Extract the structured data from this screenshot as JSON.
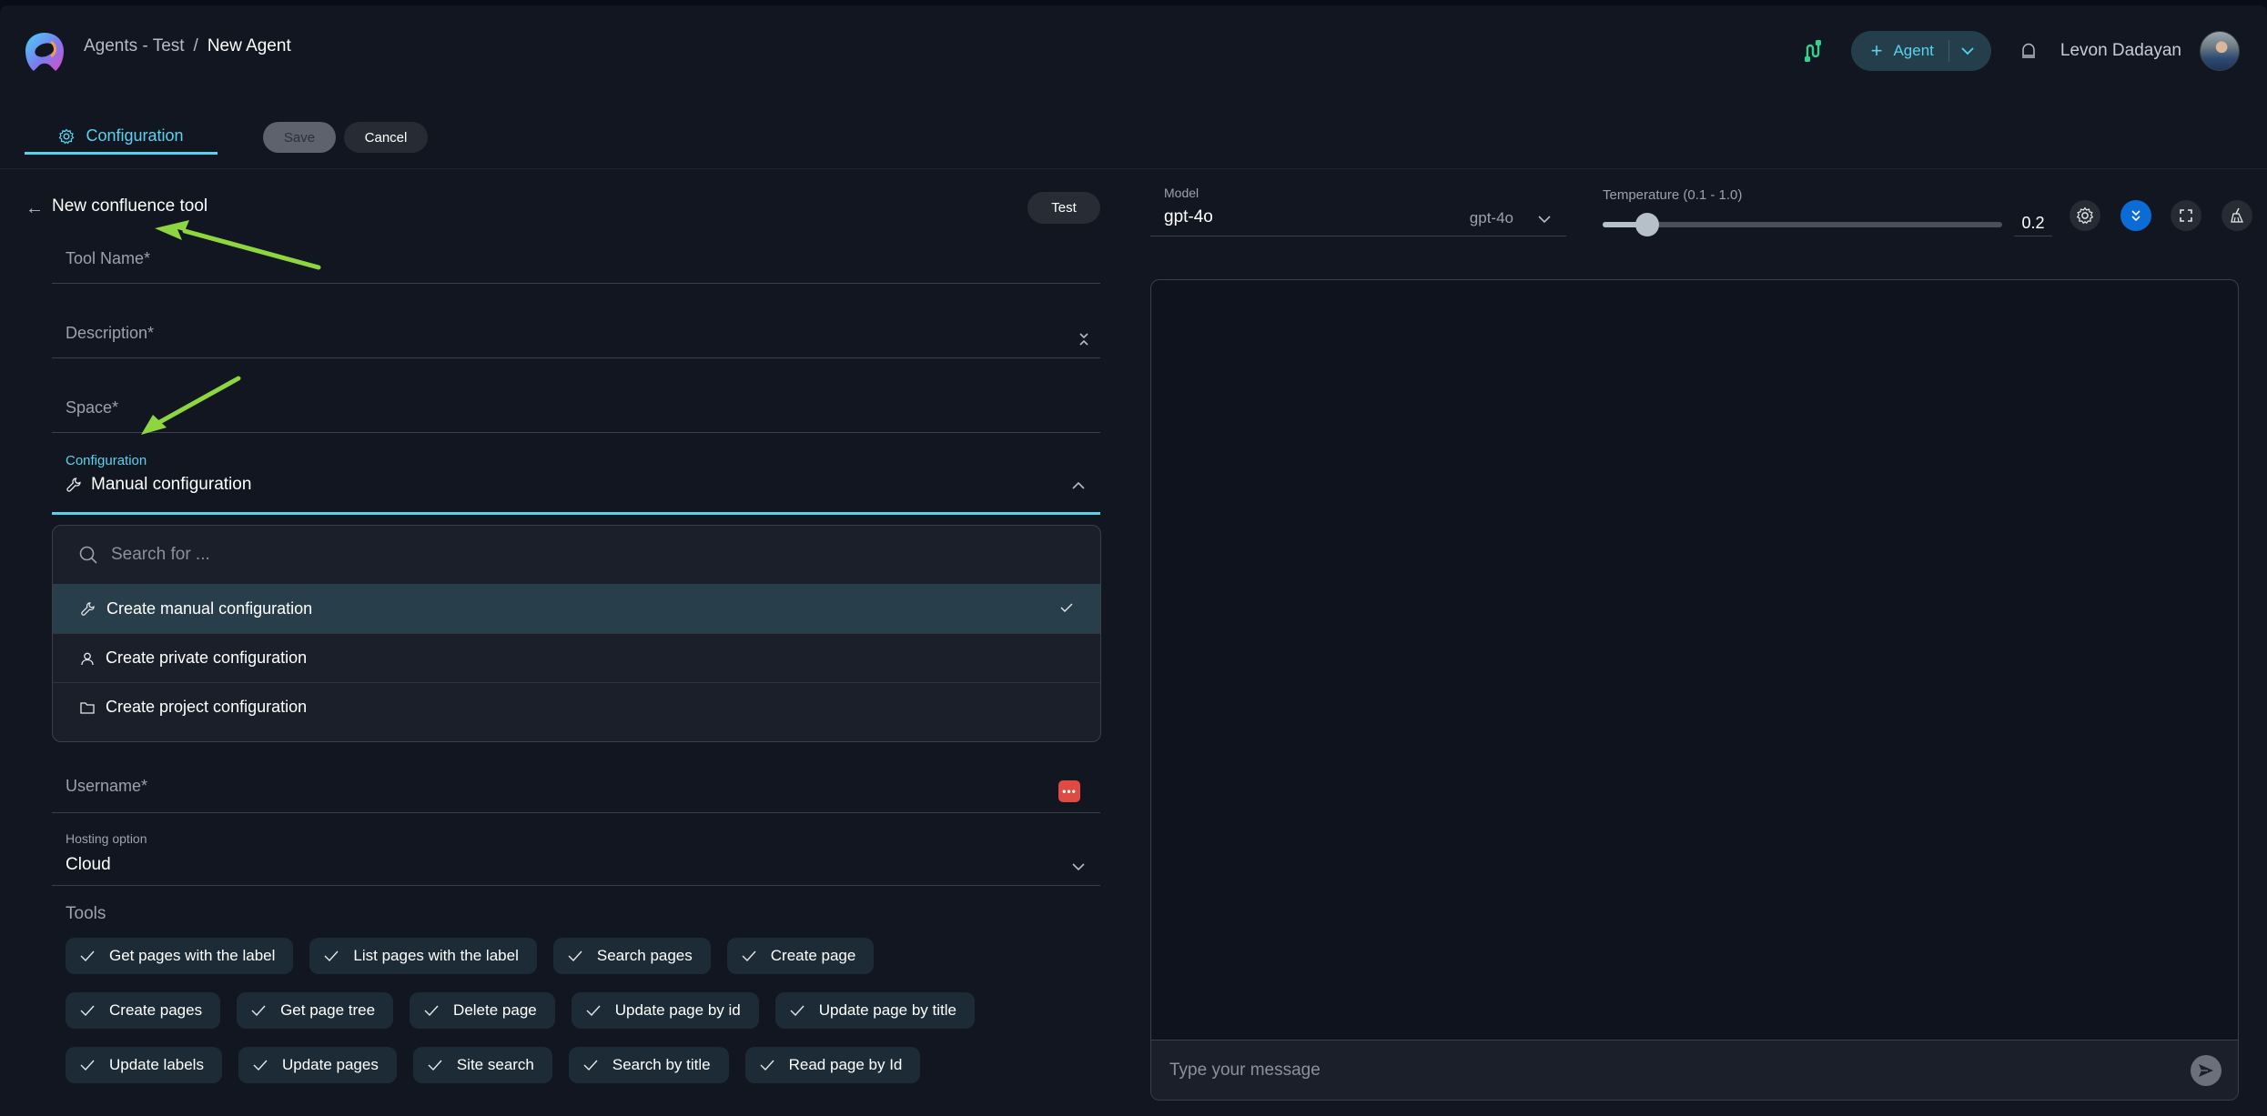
{
  "header": {
    "breadcrumb": {
      "parent": "Agents - Test",
      "separator": "/",
      "current": "New Agent"
    },
    "agent_button": {
      "label": "Agent"
    },
    "user": {
      "name": "Levon Dadayan"
    }
  },
  "tabs": {
    "configuration": "Configuration",
    "save": "Save",
    "cancel": "Cancel"
  },
  "form": {
    "title": "New confluence tool",
    "test_button": "Test",
    "fields": {
      "tool_name": {
        "label": "Tool Name*",
        "value": ""
      },
      "description": {
        "label": "Description*",
        "value": ""
      },
      "space": {
        "label": "Space*",
        "value": ""
      },
      "configuration": {
        "label": "Configuration",
        "value": "Manual configuration",
        "icon": "wrench-icon",
        "expanded": true
      },
      "username": {
        "label": "Username*",
        "value": ""
      },
      "hosting_option": {
        "label": "Hosting option",
        "value": "Cloud"
      }
    },
    "config_dropdown": {
      "search_placeholder": "Search for ...",
      "options": [
        {
          "label": "Create manual configuration",
          "icon": "wrench-icon",
          "selected": true
        },
        {
          "label": "Create private configuration",
          "icon": "user-icon",
          "selected": false
        },
        {
          "label": "Create project configuration",
          "icon": "folder-icon",
          "selected": false
        }
      ]
    },
    "tools_label": "Tools",
    "tools": [
      [
        "Get pages with the label",
        "List pages with the label",
        "Search pages",
        "Create page"
      ],
      [
        "Create pages",
        "Get page tree",
        "Delete page",
        "Update page by id",
        "Update page by title"
      ],
      [
        "Update labels",
        "Update pages",
        "Site search",
        "Search by title",
        "Read page by Id"
      ]
    ]
  },
  "chat": {
    "model": {
      "label": "Model",
      "value": "gpt-4o",
      "option": "gpt-4o"
    },
    "temperature": {
      "label": "Temperature (0.1 - 1.0)",
      "value": "0.2",
      "min": 0.1,
      "max": 1.0,
      "current": 0.2
    },
    "message_placeholder": "Type your message"
  },
  "colors": {
    "accent": "#58d3ef",
    "primary_button": "#0b6cd6",
    "selected_row": "#283f4b",
    "chip_bg": "#1c2b35",
    "annotation_arrow": "#8ed63f",
    "password_manager": "#e04a45"
  }
}
